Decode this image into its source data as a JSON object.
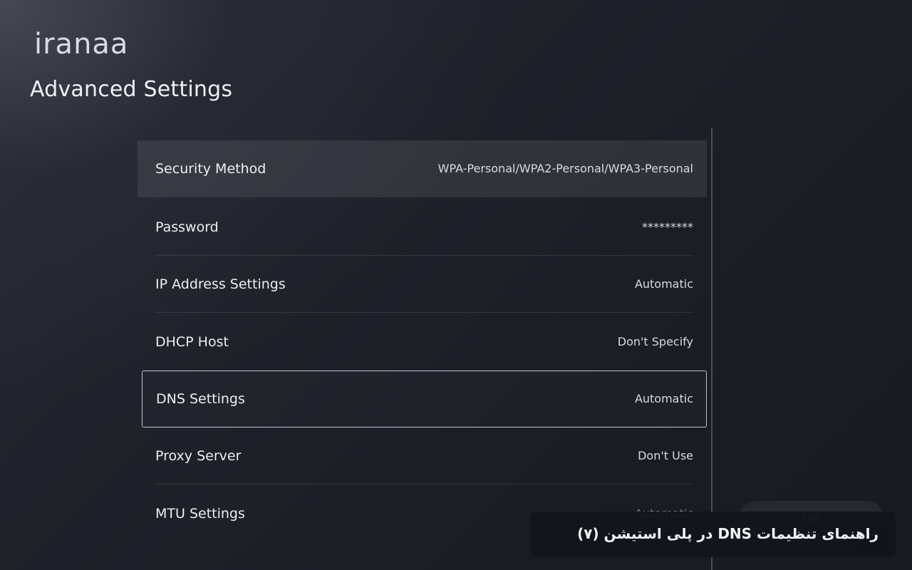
{
  "logo": {
    "text": "iranaa"
  },
  "header": {
    "title": "Advanced Settings"
  },
  "settings": [
    {
      "label": "Security Method",
      "value": "WPA-Personal/WPA2-Personal/WPA3-Personal",
      "state": "highlighted"
    },
    {
      "label": "Password",
      "value": "*********",
      "state": "normal"
    },
    {
      "label": "IP Address Settings",
      "value": "Automatic",
      "state": "normal"
    },
    {
      "label": "DHCP Host",
      "value": "Don't Specify",
      "state": "normal"
    },
    {
      "label": "DNS Settings",
      "value": "Automatic",
      "state": "focused"
    },
    {
      "label": "Proxy Server",
      "value": "Don't Use",
      "state": "normal"
    },
    {
      "label": "MTU Settings",
      "value": "Automatic",
      "state": "faded"
    }
  ],
  "ok_button": {
    "label": "OK"
  },
  "caption": {
    "text": "راهنمای تنظیمات DNS در پلی استیشن (۷)"
  },
  "colors": {
    "background": "#1f2129",
    "focus_border": "#dce2f0",
    "highlight_row": "#2e3039",
    "caption_bg": "#12141b"
  }
}
